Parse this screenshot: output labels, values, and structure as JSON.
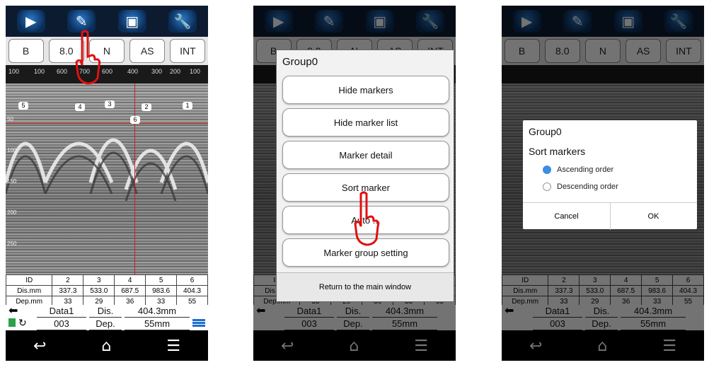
{
  "toolbar": {
    "icons": [
      "play-icon",
      "pencil-icon",
      "bag-icon",
      "wrench-icon"
    ]
  },
  "mode_buttons": [
    "B",
    "8.0",
    "N",
    "AS",
    "INT"
  ],
  "ruler_ticks": [
    "100",
    "600",
    "700",
    "600",
    "500",
    "400",
    "300",
    "200",
    "100"
  ],
  "depth_labels": [
    "50",
    "100",
    "150",
    "200",
    "250"
  ],
  "markers": [
    "5",
    "4",
    "3",
    "2",
    "1",
    "6"
  ],
  "table": {
    "rows": [
      [
        "ID",
        "2",
        "3",
        "4",
        "5",
        "6"
      ],
      [
        "Dis.mm",
        "337.3",
        "533.0",
        "687.5",
        "983.6",
        "404.3"
      ],
      [
        "Dep.mm",
        "33",
        "29",
        "36",
        "33",
        "55"
      ]
    ]
  },
  "info": {
    "data_label": "Data1",
    "dis_label": "Dis.",
    "dis_value": "404.3mm",
    "num": "003",
    "dep_label": "Dep.",
    "dep_value": "55mm"
  },
  "menu": {
    "title": "Group0",
    "items": [
      "Hide markers",
      "Hide marker list",
      "Marker detail",
      "Sort marker",
      "Auto ...",
      "Marker group setting"
    ],
    "return_label": "Return to the main window"
  },
  "sort_dialog": {
    "title": "Group0",
    "subtitle": "Sort markers",
    "options": [
      "Ascending order",
      "Descending order"
    ],
    "selected": "Ascending order",
    "cancel": "Cancel",
    "ok": "OK"
  },
  "colors": {
    "accent": "#3b8ee0",
    "marker_line": "#d02020"
  }
}
